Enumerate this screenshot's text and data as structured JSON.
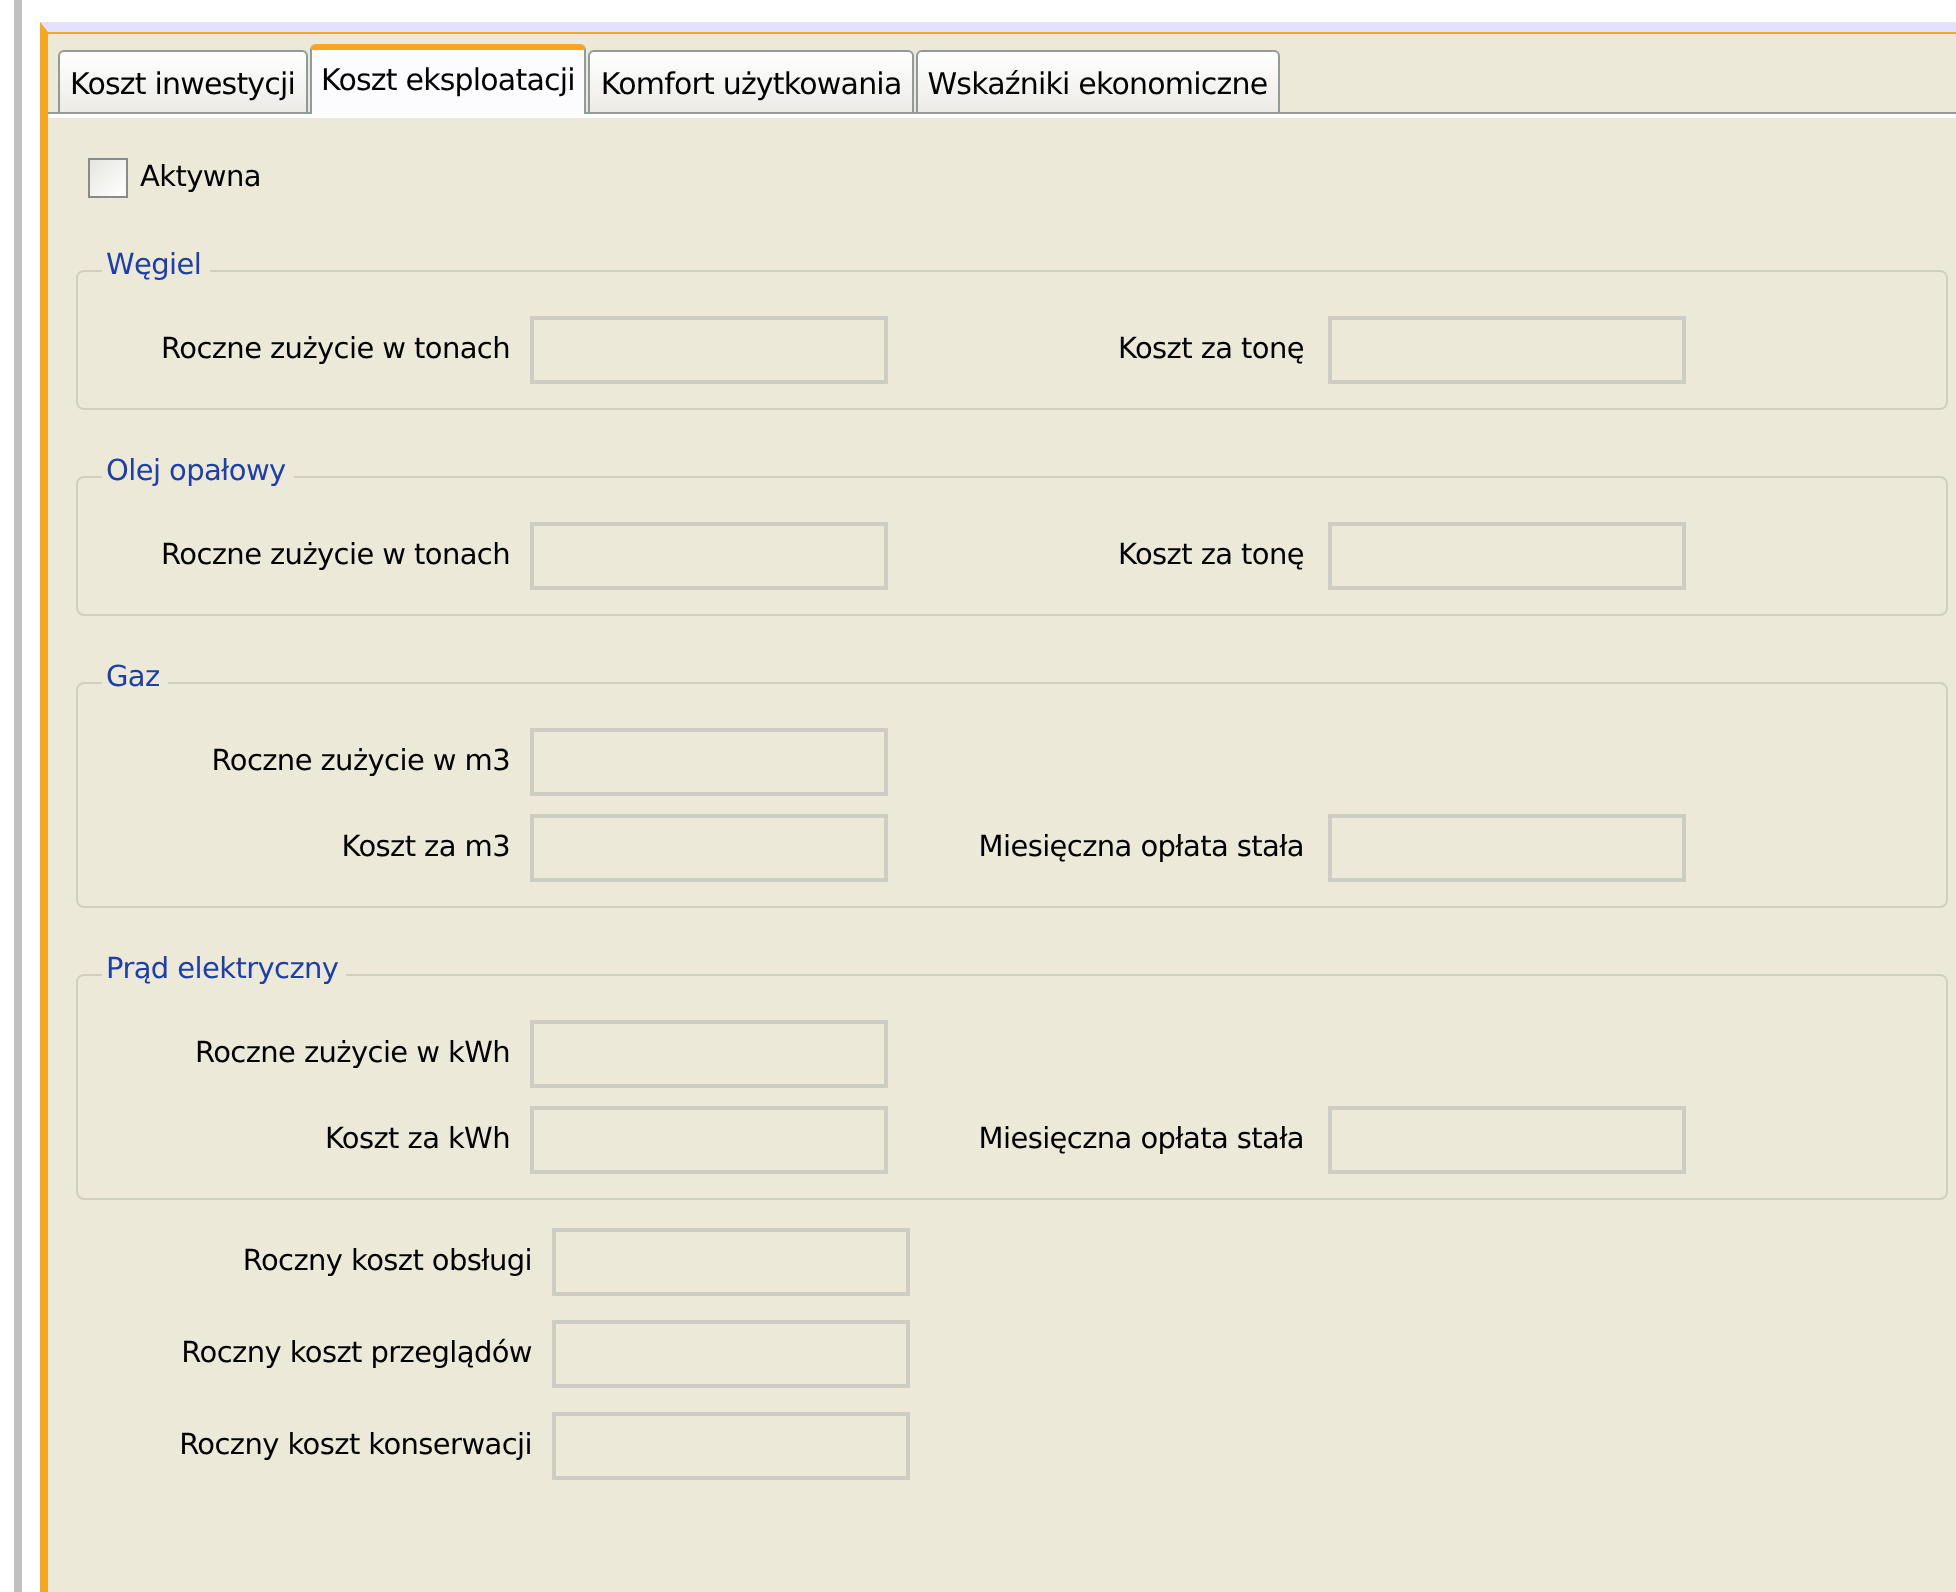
{
  "tabs": [
    {
      "label": "Koszt inwestycji",
      "selected": false
    },
    {
      "label": "Koszt eksploatacji",
      "selected": true
    },
    {
      "label": "Komfort użytkowania",
      "selected": false
    },
    {
      "label": "Wskaźniki ekonomiczne",
      "selected": false
    }
  ],
  "active_checkbox": {
    "label": "Aktywna",
    "checked": false
  },
  "groups": [
    {
      "title": "Węgiel",
      "rows": [
        {
          "label": "Roczne zużycie w tonach",
          "extra_label": "Koszt za tonę"
        }
      ]
    },
    {
      "title": "Olej opałowy",
      "rows": [
        {
          "label": "Roczne zużycie w tonach",
          "extra_label": "Koszt za tonę"
        }
      ]
    },
    {
      "title": "Gaz",
      "rows": [
        {
          "label": "Roczne zużycie w m3"
        },
        {
          "label": "Koszt za m3",
          "extra_label": "Miesięczna opłata stała"
        }
      ]
    },
    {
      "title": "Prąd elektryczny",
      "rows": [
        {
          "label": "Roczne zużycie w kWh"
        },
        {
          "label": "Koszt za kWh",
          "extra_label": "Miesięczna opłata stała"
        }
      ]
    }
  ],
  "fields": [
    {
      "label": "Roczny koszt obsługi"
    },
    {
      "label": "Roczny koszt przeglądów"
    },
    {
      "label": "Roczny koszt konserwacji"
    }
  ]
}
